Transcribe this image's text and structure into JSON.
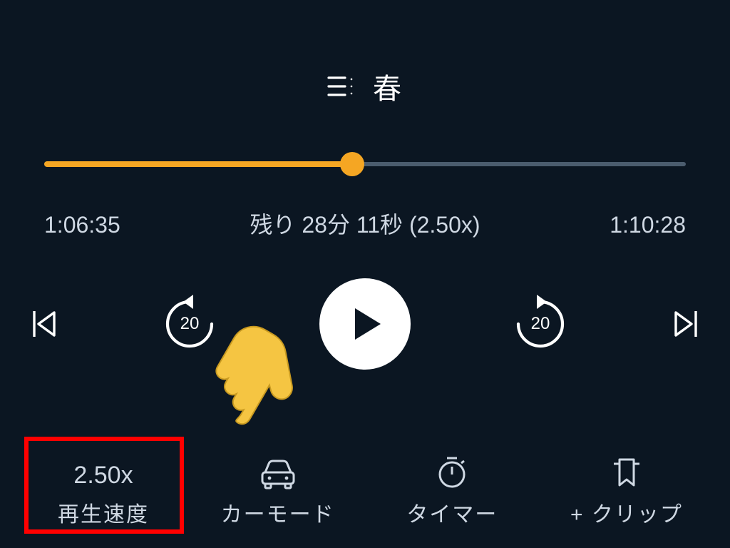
{
  "title": {
    "text": "春"
  },
  "progress": {
    "percent": 48,
    "elapsed": "1:06:35",
    "remaining_label": "残り 28分 11秒 (2.50x)",
    "total": "1:10:28"
  },
  "seek": {
    "back_seconds": "20",
    "fwd_seconds": "20"
  },
  "bottom": {
    "speed": {
      "value": "2.50x",
      "label": "再生速度"
    },
    "carmode": {
      "label": "カーモード"
    },
    "timer": {
      "label": "タイマー"
    },
    "clip": {
      "label": "+ クリップ"
    }
  },
  "colors": {
    "accent": "#f5a623",
    "highlight": "#ff0000"
  }
}
